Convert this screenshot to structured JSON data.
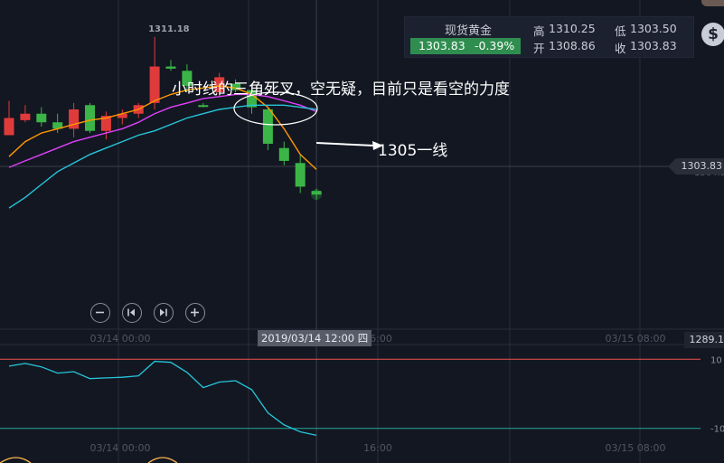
{
  "chart_data": [
    {
      "type": "candlestick",
      "title": "",
      "series": [
        {
          "name": "",
          "kind": "candles",
          "values": [
            {
              "o": 1307.4,
              "h": 1308.2,
              "l": 1306.6,
              "c": 1306.6,
              "color": "red"
            },
            {
              "o": 1307.6,
              "h": 1308.0,
              "l": 1307.2,
              "c": 1307.3,
              "color": "red"
            },
            {
              "o": 1307.2,
              "h": 1307.9,
              "l": 1307.0,
              "c": 1307.6,
              "color": "green"
            },
            {
              "o": 1307.2,
              "h": 1307.6,
              "l": 1306.7,
              "c": 1306.9,
              "color": "green"
            },
            {
              "o": 1306.9,
              "h": 1308.1,
              "l": 1306.5,
              "c": 1307.8,
              "color": "red"
            },
            {
              "o": 1308.0,
              "h": 1308.1,
              "l": 1306.7,
              "c": 1306.8,
              "color": "green"
            },
            {
              "o": 1306.8,
              "h": 1307.7,
              "l": 1306.4,
              "c": 1307.5,
              "color": "red"
            },
            {
              "o": 1307.4,
              "h": 1307.8,
              "l": 1307.1,
              "c": 1307.6,
              "color": "red"
            },
            {
              "o": 1307.6,
              "h": 1308.1,
              "l": 1307.4,
              "c": 1308.0,
              "color": "red"
            },
            {
              "o": 1308.1,
              "h": 1311.18,
              "l": 1307.8,
              "c": 1309.8,
              "color": "red"
            },
            {
              "o": 1309.8,
              "h": 1310.1,
              "l": 1309.6,
              "c": 1309.7,
              "color": "green"
            },
            {
              "o": 1309.6,
              "h": 1309.9,
              "l": 1308.6,
              "c": 1308.9,
              "color": "green"
            },
            {
              "o": 1308.0,
              "h": 1308.1,
              "l": 1307.9,
              "c": 1308.0,
              "color": "green"
            },
            {
              "o": 1308.6,
              "h": 1309.5,
              "l": 1308.4,
              "c": 1309.3,
              "color": "red"
            },
            {
              "o": 1309.0,
              "h": 1309.2,
              "l": 1308.6,
              "c": 1308.7,
              "color": "green"
            },
            {
              "o": 1308.7,
              "h": 1308.9,
              "l": 1307.6,
              "c": 1307.9,
              "color": "green"
            },
            {
              "o": 1307.8,
              "h": 1307.9,
              "l": 1305.9,
              "c": 1306.2,
              "color": "green"
            },
            {
              "o": 1306.0,
              "h": 1306.3,
              "l": 1305.2,
              "c": 1305.4,
              "color": "green"
            },
            {
              "o": 1305.3,
              "h": 1305.7,
              "l": 1303.9,
              "c": 1304.2,
              "color": "green"
            },
            {
              "o": 1304.0,
              "h": 1304.1,
              "l": 1303.6,
              "c": 1303.83,
              "color": "green"
            }
          ]
        },
        {
          "name": "",
          "kind": "line",
          "color": "#ff9800",
          "values": [
            1305.6,
            1306.3,
            1306.7,
            1306.9,
            1307.1,
            1307.3,
            1307.4,
            1307.6,
            1307.8,
            1308.2,
            1308.5,
            1308.7,
            1308.8,
            1308.9,
            1308.8,
            1308.5,
            1307.9,
            1306.9,
            1305.7,
            1305.0
          ]
        },
        {
          "name": "",
          "kind": "line",
          "color": "#e040fb",
          "values": [
            1305.1,
            1305.4,
            1305.7,
            1306.0,
            1306.3,
            1306.5,
            1306.7,
            1306.9,
            1307.2,
            1307.6,
            1307.9,
            1308.1,
            1308.3,
            1308.4,
            1308.5,
            1308.5,
            1308.4,
            1308.2,
            1308.0,
            1307.7
          ]
        },
        {
          "name": "",
          "kind": "line",
          "color": "#26c6da",
          "values": [
            1303.2,
            1303.7,
            1304.3,
            1304.9,
            1305.3,
            1305.7,
            1306.0,
            1306.3,
            1306.6,
            1306.8,
            1307.1,
            1307.4,
            1307.6,
            1307.8,
            1307.9,
            1308.0,
            1308.0,
            1308.0,
            1307.9,
            1307.8
          ]
        }
      ],
      "ylim": [
        1297.6,
        1312.9
      ],
      "y_ticks": [
        "1304.9"
      ],
      "current_price": "1303.83",
      "high_marker": "1311.18",
      "x_ticks": [
        "03/14 00:00",
        "16:00",
        "03/15 08:00"
      ],
      "crosshair_label": "2019/03/14 12:00 四",
      "axis_label_right": "1289.1",
      "annotations": [
        {
          "text": "小时线的三角死叉，空无疑，目前只是看空的力度"
        },
        {
          "text": "1305一线"
        }
      ]
    },
    {
      "type": "line",
      "title": "",
      "series": [
        {
          "name": "",
          "color": "#26c6da",
          "values": [
            80,
            88,
            78,
            60,
            64,
            44,
            46,
            48,
            52,
            94,
            91,
            62,
            18,
            34,
            38,
            12,
            -55,
            -90,
            -110,
            -120
          ]
        }
      ],
      "levels": [
        {
          "value": 100,
          "label": "10",
          "color": "#ef5350"
        },
        {
          "value": -100,
          "label": "-10",
          "color": "#26a69a"
        }
      ],
      "ylim": [
        -140,
        140
      ],
      "x_ticks": [
        "03/14 00:00",
        "16:00",
        "03/15 08:00"
      ]
    }
  ],
  "ticker": {
    "name": "现货黄金",
    "price": "1303.83",
    "change": "-0.39%",
    "high_label": "高",
    "high": "1310.25",
    "low_label": "低",
    "low": "1303.50",
    "open_label": "开",
    "open": "1308.86",
    "close_label": "收",
    "close": "1303.83",
    "dollar_symbol": "$"
  },
  "colors": {
    "up": "#e03b3b",
    "down": "#3bb547",
    "bg": "#131722",
    "grid": "#2a2e39"
  },
  "icons": [
    "zoom-out-icon",
    "prev-icon",
    "next-icon",
    "zoom-in-icon",
    "dollar-icon"
  ]
}
